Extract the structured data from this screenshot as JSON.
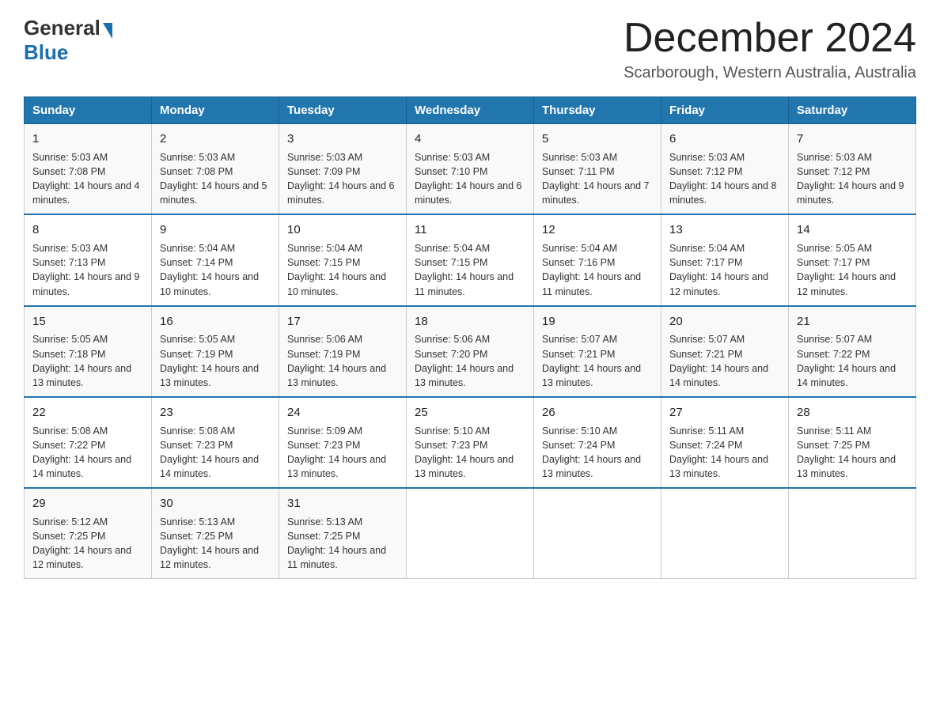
{
  "header": {
    "logo_general": "General",
    "logo_blue": "Blue",
    "month_title": "December 2024",
    "location": "Scarborough, Western Australia, Australia"
  },
  "weekdays": [
    "Sunday",
    "Monday",
    "Tuesday",
    "Wednesday",
    "Thursday",
    "Friday",
    "Saturday"
  ],
  "weeks": [
    [
      {
        "day": "1",
        "sunrise": "5:03 AM",
        "sunset": "7:08 PM",
        "daylight": "14 hours and 4 minutes."
      },
      {
        "day": "2",
        "sunrise": "5:03 AM",
        "sunset": "7:08 PM",
        "daylight": "14 hours and 5 minutes."
      },
      {
        "day": "3",
        "sunrise": "5:03 AM",
        "sunset": "7:09 PM",
        "daylight": "14 hours and 6 minutes."
      },
      {
        "day": "4",
        "sunrise": "5:03 AM",
        "sunset": "7:10 PM",
        "daylight": "14 hours and 6 minutes."
      },
      {
        "day": "5",
        "sunrise": "5:03 AM",
        "sunset": "7:11 PM",
        "daylight": "14 hours and 7 minutes."
      },
      {
        "day": "6",
        "sunrise": "5:03 AM",
        "sunset": "7:12 PM",
        "daylight": "14 hours and 8 minutes."
      },
      {
        "day": "7",
        "sunrise": "5:03 AM",
        "sunset": "7:12 PM",
        "daylight": "14 hours and 9 minutes."
      }
    ],
    [
      {
        "day": "8",
        "sunrise": "5:03 AM",
        "sunset": "7:13 PM",
        "daylight": "14 hours and 9 minutes."
      },
      {
        "day": "9",
        "sunrise": "5:04 AM",
        "sunset": "7:14 PM",
        "daylight": "14 hours and 10 minutes."
      },
      {
        "day": "10",
        "sunrise": "5:04 AM",
        "sunset": "7:15 PM",
        "daylight": "14 hours and 10 minutes."
      },
      {
        "day": "11",
        "sunrise": "5:04 AM",
        "sunset": "7:15 PM",
        "daylight": "14 hours and 11 minutes."
      },
      {
        "day": "12",
        "sunrise": "5:04 AM",
        "sunset": "7:16 PM",
        "daylight": "14 hours and 11 minutes."
      },
      {
        "day": "13",
        "sunrise": "5:04 AM",
        "sunset": "7:17 PM",
        "daylight": "14 hours and 12 minutes."
      },
      {
        "day": "14",
        "sunrise": "5:05 AM",
        "sunset": "7:17 PM",
        "daylight": "14 hours and 12 minutes."
      }
    ],
    [
      {
        "day": "15",
        "sunrise": "5:05 AM",
        "sunset": "7:18 PM",
        "daylight": "14 hours and 13 minutes."
      },
      {
        "day": "16",
        "sunrise": "5:05 AM",
        "sunset": "7:19 PM",
        "daylight": "14 hours and 13 minutes."
      },
      {
        "day": "17",
        "sunrise": "5:06 AM",
        "sunset": "7:19 PM",
        "daylight": "14 hours and 13 minutes."
      },
      {
        "day": "18",
        "sunrise": "5:06 AM",
        "sunset": "7:20 PM",
        "daylight": "14 hours and 13 minutes."
      },
      {
        "day": "19",
        "sunrise": "5:07 AM",
        "sunset": "7:21 PM",
        "daylight": "14 hours and 13 minutes."
      },
      {
        "day": "20",
        "sunrise": "5:07 AM",
        "sunset": "7:21 PM",
        "daylight": "14 hours and 14 minutes."
      },
      {
        "day": "21",
        "sunrise": "5:07 AM",
        "sunset": "7:22 PM",
        "daylight": "14 hours and 14 minutes."
      }
    ],
    [
      {
        "day": "22",
        "sunrise": "5:08 AM",
        "sunset": "7:22 PM",
        "daylight": "14 hours and 14 minutes."
      },
      {
        "day": "23",
        "sunrise": "5:08 AM",
        "sunset": "7:23 PM",
        "daylight": "14 hours and 14 minutes."
      },
      {
        "day": "24",
        "sunrise": "5:09 AM",
        "sunset": "7:23 PM",
        "daylight": "14 hours and 13 minutes."
      },
      {
        "day": "25",
        "sunrise": "5:10 AM",
        "sunset": "7:23 PM",
        "daylight": "14 hours and 13 minutes."
      },
      {
        "day": "26",
        "sunrise": "5:10 AM",
        "sunset": "7:24 PM",
        "daylight": "14 hours and 13 minutes."
      },
      {
        "day": "27",
        "sunrise": "5:11 AM",
        "sunset": "7:24 PM",
        "daylight": "14 hours and 13 minutes."
      },
      {
        "day": "28",
        "sunrise": "5:11 AM",
        "sunset": "7:25 PM",
        "daylight": "14 hours and 13 minutes."
      }
    ],
    [
      {
        "day": "29",
        "sunrise": "5:12 AM",
        "sunset": "7:25 PM",
        "daylight": "14 hours and 12 minutes."
      },
      {
        "day": "30",
        "sunrise": "5:13 AM",
        "sunset": "7:25 PM",
        "daylight": "14 hours and 12 minutes."
      },
      {
        "day": "31",
        "sunrise": "5:13 AM",
        "sunset": "7:25 PM",
        "daylight": "14 hours and 11 minutes."
      },
      null,
      null,
      null,
      null
    ]
  ]
}
